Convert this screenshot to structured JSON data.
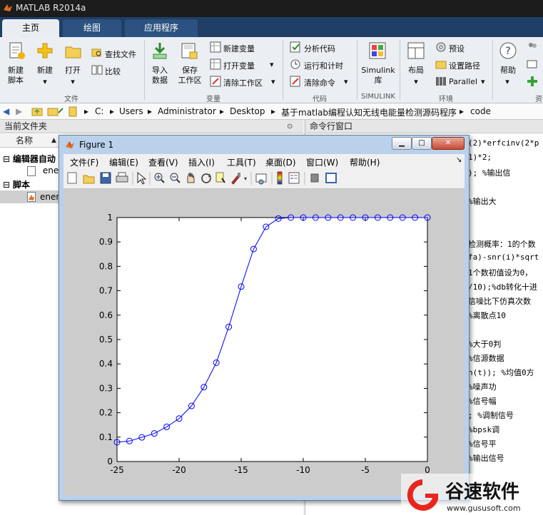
{
  "app": {
    "title": "MATLAB R2014a"
  },
  "tabs": [
    {
      "label": "主页",
      "active": true
    },
    {
      "label": "绘图",
      "active": false
    },
    {
      "label": "应用程序",
      "active": false
    }
  ],
  "ribbon": {
    "new_script": "新建\n脚本",
    "new": "新建",
    "open": "打开",
    "find_files": "查找文件",
    "compare": "比较",
    "section_file": "文件",
    "import_data": "导入\n数据",
    "save_workspace": "保存\n工作区",
    "new_variable": "新建变量",
    "open_variable": "打开变量",
    "clear_workspace": "清除工作区",
    "section_variable": "变量",
    "analyze_code": "分析代码",
    "run_and_time": "运行和计时",
    "clear_commands": "清除命令",
    "section_code": "代码",
    "simulink": "Simulink\n库",
    "section_simulink": "SIMULINK",
    "layout": "布局",
    "preferences": "预设",
    "set_path": "设置路径",
    "parallel": "Parallel",
    "section_env": "环境",
    "help": "帮助",
    "section_resources": "资源"
  },
  "address": {
    "parts": [
      "C:",
      "Users",
      "Administrator",
      "Desktop",
      "基于matlab编程认知无线电能量检测源码程序",
      "code"
    ]
  },
  "current_folder": {
    "title": "当前文件夹",
    "col_name": "名称",
    "group_editor": "编辑器自动",
    "file1": "ener",
    "group_script": "脚本",
    "file2": "ener"
  },
  "command_window": {
    "title": "命令行窗口",
    "lines": [
      "(2)*erfcinv(2*p",
      "1)*2;",
      ");        %输出信",
      "           %输出大",
      "检测概率：1的个数",
      "fa)-snr(i)*sqrt",
      "1个数初值设为0，",
      "/10);%db转化十进",
      "信噪比下仿真次数",
      "           %离散点10",
      "           %大于0判",
      "           %信源数据",
      "h(t));  %均值0方",
      "           %噪声功",
      "           %信号幅",
      ";         %调制信号",
      "           %bpsk调",
      "           %信号平",
      "           %输出信号"
    ]
  },
  "figure": {
    "title": "Figure 1",
    "menu": [
      "文件(F)",
      "编辑(E)",
      "查看(V)",
      "插入(I)",
      "工具(T)",
      "桌面(D)",
      "窗口(W)",
      "帮助(H)"
    ]
  },
  "chart_data": {
    "type": "line",
    "title": "",
    "xlabel": "",
    "ylabel": "",
    "xlim": [
      -25,
      0
    ],
    "ylim": [
      0,
      1
    ],
    "xticks": [
      -25,
      -20,
      -15,
      -10,
      -5,
      0
    ],
    "yticks": [
      0,
      0.1,
      0.2,
      0.3,
      0.4,
      0.5,
      0.6,
      0.7,
      0.8,
      0.9,
      1
    ],
    "ytick_labels": [
      "0",
      "0.1",
      "0.2",
      "0.3",
      "0.4",
      "0.5",
      "0.6",
      "0.7",
      "0.8",
      "0.9",
      "1"
    ],
    "series": [
      {
        "color": "#0000ff",
        "marker": "circle",
        "x": [
          -25,
          -24,
          -23,
          -22,
          -21,
          -20,
          -19,
          -18,
          -17,
          -16,
          -15,
          -14,
          -13,
          -12,
          -11,
          -10,
          -9,
          -8,
          -7,
          -6,
          -5,
          -4,
          -3,
          -2,
          -1,
          0
        ],
        "y": [
          0.079,
          0.084,
          0.099,
          0.115,
          0.142,
          0.176,
          0.228,
          0.305,
          0.405,
          0.552,
          0.717,
          0.871,
          0.962,
          0.996,
          1,
          1,
          1,
          1,
          1,
          1,
          1,
          1,
          1,
          1,
          1,
          1
        ]
      }
    ]
  },
  "watermark": {
    "brand": "谷速软件",
    "url": "www.gususoft.com"
  }
}
